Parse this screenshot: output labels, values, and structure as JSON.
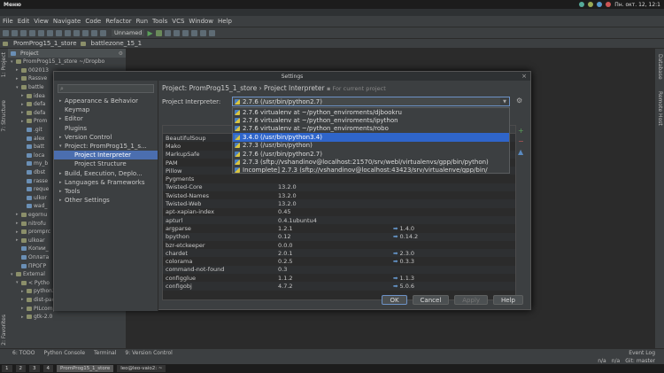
{
  "os_bar": {
    "menu_label": "Меню",
    "clock": "Пн. окт. 12, 12:1"
  },
  "menubar": [
    "File",
    "Edit",
    "View",
    "Navigate",
    "Code",
    "Refactor",
    "Run",
    "Tools",
    "VCS",
    "Window",
    "Help"
  ],
  "toolbar": {
    "run_config": "Unnamed"
  },
  "breadcrumb": [
    "PromProg15_1_store",
    "battlezone_15_1"
  ],
  "project_panel": {
    "header": "Project",
    "root": "PromProg15_1_store ~/Dropbo",
    "rows": [
      {
        "indent": 1,
        "label": "002013",
        "tri": "▸"
      },
      {
        "indent": 1,
        "label": "Rassve",
        "tri": "▸"
      },
      {
        "indent": 1,
        "label": "battle",
        "tri": "▾"
      },
      {
        "indent": 2,
        "label": "idea",
        "tri": "▸"
      },
      {
        "indent": 2,
        "label": "defa",
        "tri": "▸"
      },
      {
        "indent": 2,
        "label": "defa",
        "tri": "▸"
      },
      {
        "indent": 2,
        "label": "Prom",
        "tri": "▸"
      },
      {
        "indent": 2,
        "label": ".git",
        "tri": ""
      },
      {
        "indent": 2,
        "label": "alex",
        "tri": ""
      },
      {
        "indent": 2,
        "label": "batt",
        "tri": ""
      },
      {
        "indent": 2,
        "label": "loca",
        "tri": ""
      },
      {
        "indent": 2,
        "label": "my_b",
        "tri": ""
      },
      {
        "indent": 2,
        "label": "dbst",
        "tri": ""
      },
      {
        "indent": 2,
        "label": "rasse",
        "tri": ""
      },
      {
        "indent": 2,
        "label": "reque",
        "tri": ""
      },
      {
        "indent": 2,
        "label": "ulkor",
        "tri": ""
      },
      {
        "indent": 2,
        "label": "wad_",
        "tri": ""
      },
      {
        "indent": 1,
        "label": "egornu",
        "tri": "▸"
      },
      {
        "indent": 1,
        "label": "nitrofu",
        "tri": "▸"
      },
      {
        "indent": 1,
        "label": "promprc",
        "tri": "▸"
      },
      {
        "indent": 1,
        "label": "ulkoar",
        "tri": "▸"
      },
      {
        "indent": 1,
        "label": "Копии_",
        "tri": ""
      },
      {
        "indent": 1,
        "label": "Оплата",
        "tri": ""
      },
      {
        "indent": 1,
        "label": "ПРОГР",
        "tri": ""
      },
      {
        "indent": 0,
        "label": "External",
        "tri": "▾"
      },
      {
        "indent": 1,
        "label": "< Pytho",
        "tri": "▾"
      },
      {
        "indent": 2,
        "label": "python2.7 /library root",
        "tri": "▸"
      },
      {
        "indent": 2,
        "label": "dist-packages",
        "tri": "▸"
      },
      {
        "indent": 2,
        "label": "PILcompat",
        "tri": "▸"
      },
      {
        "indent": 2,
        "label": "gtk-2.0",
        "tri": "▸"
      }
    ]
  },
  "left_tabs": [
    "1: Project",
    "7: Structure"
  ],
  "right_tabs": [
    "Database",
    "Remote Host"
  ],
  "bottom_left_tab": "2: Favorites",
  "dialog": {
    "title": "Settings",
    "search_placeholder": "",
    "nav": [
      {
        "label": "Appearance & Behavior",
        "arrow": "▸",
        "sub": false,
        "sel": false
      },
      {
        "label": "Keymap",
        "arrow": "",
        "sub": false,
        "sel": false
      },
      {
        "label": "Editor",
        "arrow": "▸",
        "sub": false,
        "sel": false
      },
      {
        "label": "Plugins",
        "arrow": "",
        "sub": false,
        "sel": false
      },
      {
        "label": "Version Control",
        "arrow": "▸",
        "sub": false,
        "sel": false
      },
      {
        "label": "Project: PromProg15_1_s...",
        "arrow": "▾",
        "sub": false,
        "sel": false
      },
      {
        "label": "Project Interpreter",
        "arrow": "",
        "sub": true,
        "sel": true
      },
      {
        "label": "Project Structure",
        "arrow": "",
        "sub": true,
        "sel": false
      },
      {
        "label": "Build, Execution, Deplo...",
        "arrow": "▸",
        "sub": false,
        "sel": false
      },
      {
        "label": "Languages & Frameworks",
        "arrow": "▸",
        "sub": false,
        "sel": false
      },
      {
        "label": "Tools",
        "arrow": "▸",
        "sub": false,
        "sel": false
      },
      {
        "label": "Other Settings",
        "arrow": "▸",
        "sub": false,
        "sel": false
      }
    ],
    "crumb_main": "Project: PromProg15_1_store › Project Interpreter",
    "crumb_note": "For current project",
    "interpreter_label": "Project Interpreter:",
    "interpreter_value": "2.7.6 (/usr/bin/python2.7)",
    "dropdown_items": [
      {
        "text": "2.7.6 virtualenv at ~/python_enviroments/djbookru",
        "sel": false
      },
      {
        "text": "2.7.6 virtualenv at ~/python_enviroments/ipython",
        "sel": false
      },
      {
        "text": "2.7.6 virtualenv at ~/python_enviroments/robo",
        "sel": false
      },
      {
        "text": "3.4.0 (/usr/bin/python3.4)",
        "sel": true
      },
      {
        "text": "2.7.3 (/usr/bin/python)",
        "sel": false
      },
      {
        "text": "2.7.6 (/usr/bin/python2.7)",
        "sel": false
      },
      {
        "text": "2.7.3 (sftp://vshandinov@localhost:21570/srv/webl/virtualenvs/gpp/bin/python)",
        "sel": false
      },
      {
        "text": "Incomplete] 2.7.3 (sftp://vshandinov@localhost:43423/srv/virtualenve/gpp/bin/",
        "sel": false
      }
    ],
    "table_header": "Package",
    "packages": [
      {
        "name": "BeautifulSoup",
        "version": "",
        "latest": ""
      },
      {
        "name": "Mako",
        "version": "",
        "latest": ""
      },
      {
        "name": "MarkupSafe",
        "version": "",
        "latest": ""
      },
      {
        "name": "PAM",
        "version": "",
        "latest": ""
      },
      {
        "name": "Pillow",
        "version": "",
        "latest": ""
      },
      {
        "name": "Pygments",
        "version": "",
        "latest": ""
      },
      {
        "name": "Twisted-Core",
        "version": "13.2.0",
        "latest": ""
      },
      {
        "name": "Twisted-Names",
        "version": "13.2.0",
        "latest": ""
      },
      {
        "name": "Twisted-Web",
        "version": "13.2.0",
        "latest": ""
      },
      {
        "name": "apt-xapian-index",
        "version": "0.45",
        "latest": ""
      },
      {
        "name": "apturl",
        "version": "0.4.1ubuntu4",
        "latest": ""
      },
      {
        "name": "argparse",
        "version": "1.2.1",
        "latest": "1.4.0"
      },
      {
        "name": "bpython",
        "version": "0.12",
        "latest": "0.14.2"
      },
      {
        "name": "bzr-etckeeper",
        "version": "0.0.0",
        "latest": ""
      },
      {
        "name": "chardet",
        "version": "2.0.1",
        "latest": "2.3.0"
      },
      {
        "name": "colorama",
        "version": "0.2.5",
        "latest": "0.3.3"
      },
      {
        "name": "command-not-found",
        "version": "0.3",
        "latest": ""
      },
      {
        "name": "configglue",
        "version": "1.1.2",
        "latest": "1.1.3"
      },
      {
        "name": "configobj",
        "version": "4.7.2",
        "latest": "5.0.6"
      }
    ],
    "buttons": {
      "ok": "OK",
      "cancel": "Cancel",
      "apply": "Apply",
      "help": "Help"
    }
  },
  "tool_windows": [
    "6: TODO",
    "Python Console",
    "Terminal",
    "9: Version Control"
  ],
  "event_log": "Event Log",
  "status": {
    "pos": "n/a",
    "pos2": "n/a",
    "git": "Git: master"
  },
  "taskbar": [
    "1",
    "2",
    "3",
    "4",
    "PromProg15_1_store",
    "leo@leo-vaio2: ~"
  ]
}
